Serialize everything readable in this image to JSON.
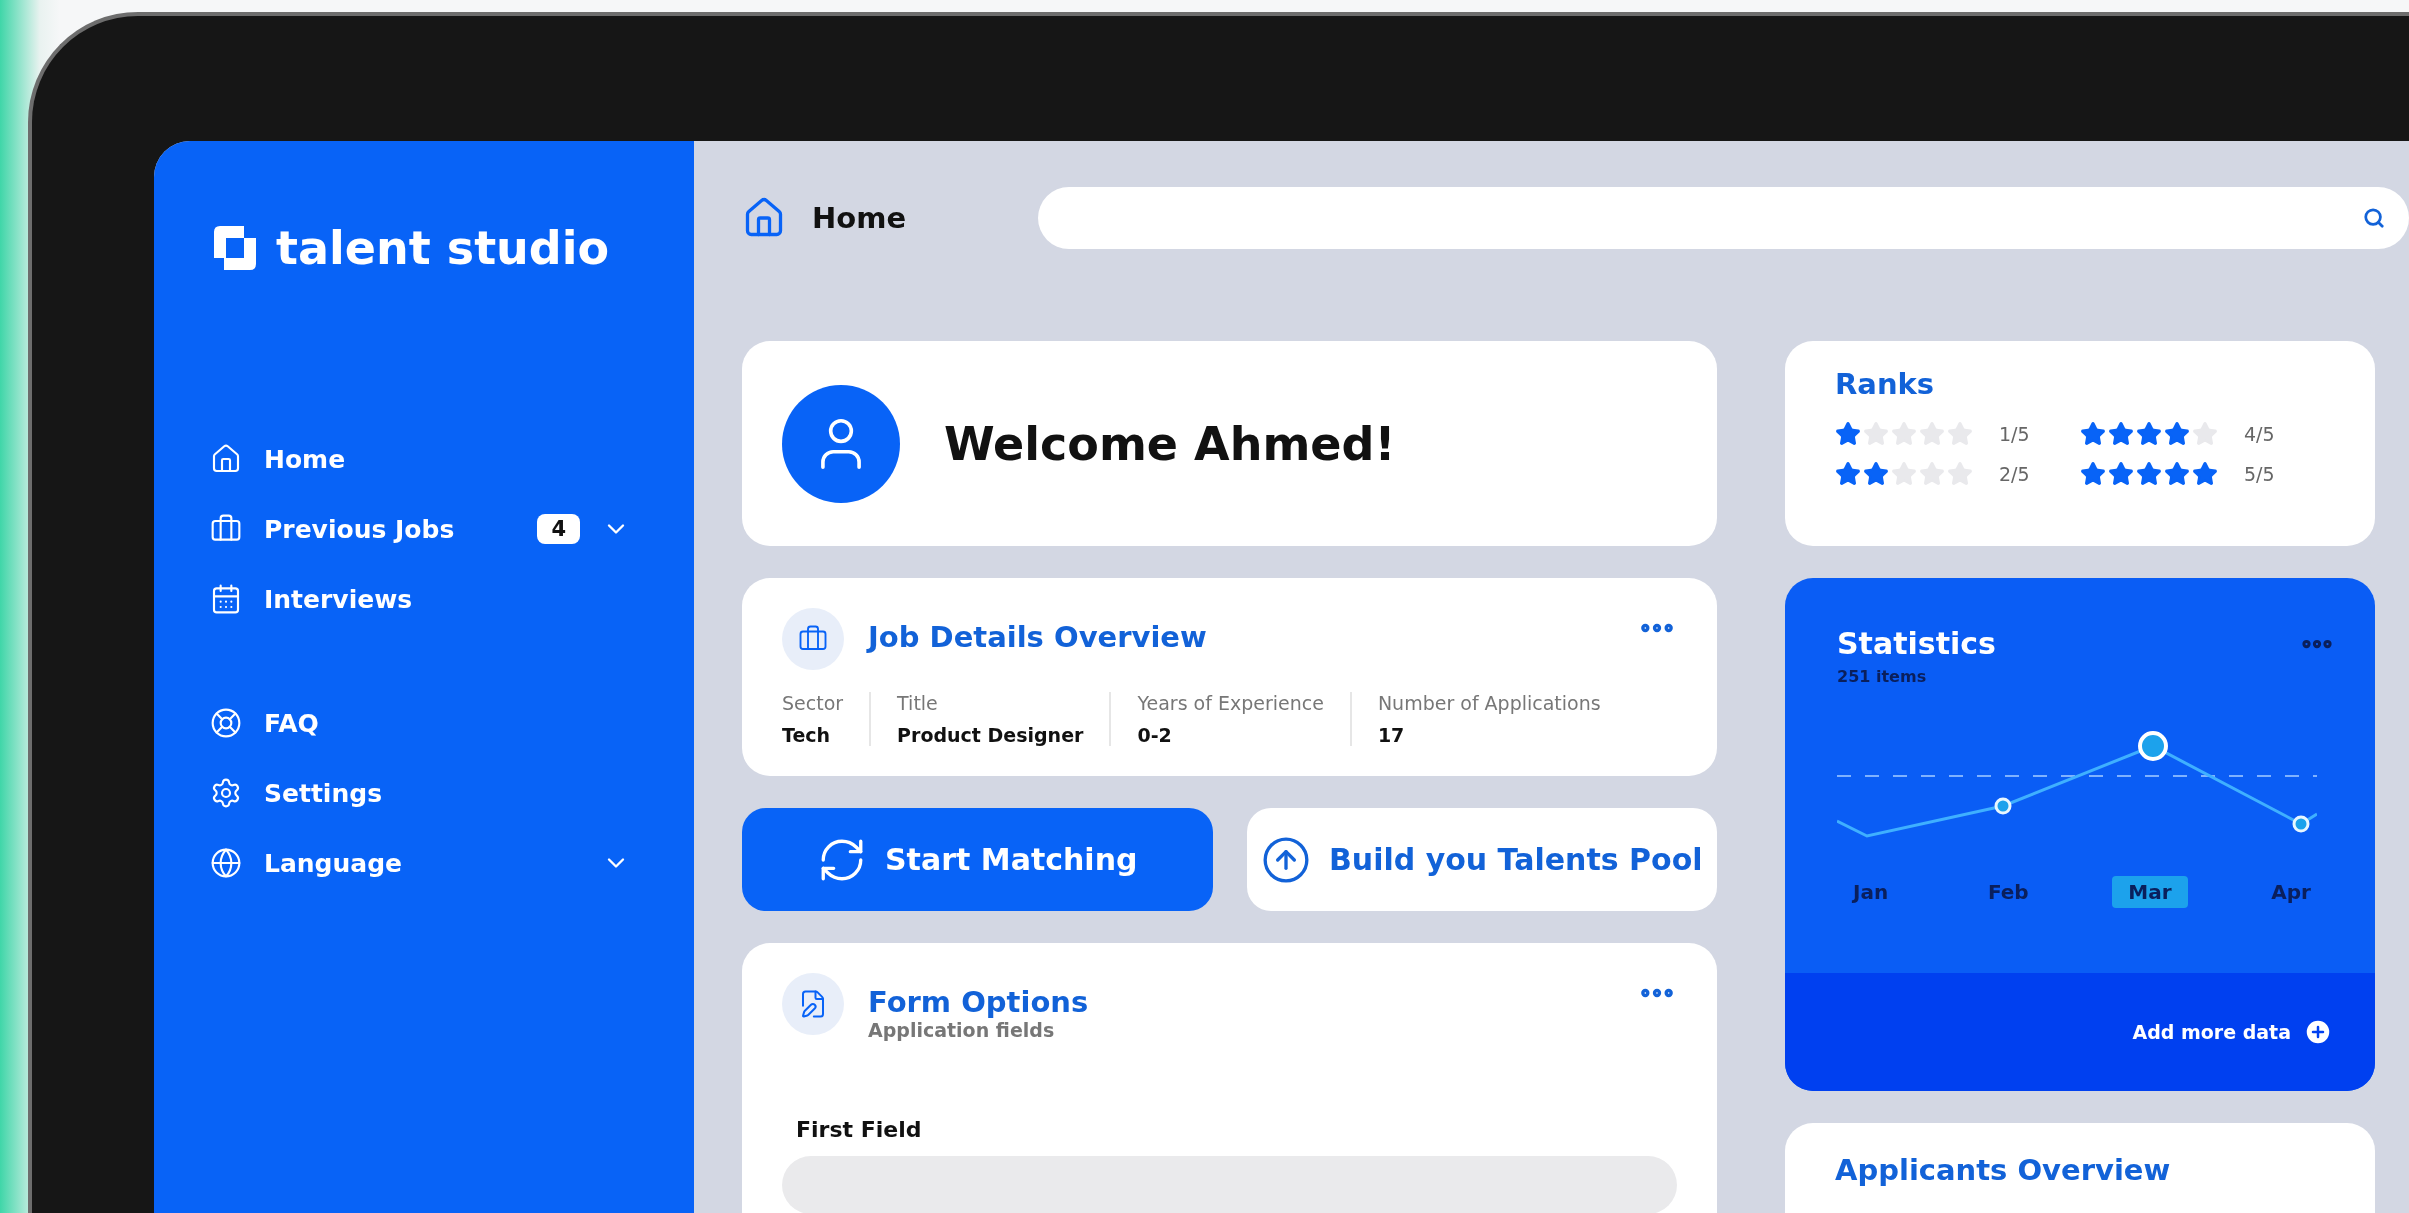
{
  "sidebar": {
    "logo": "talent studio",
    "nav": [
      {
        "label": "Home",
        "expandable": false
      },
      {
        "label": "Previous Jobs",
        "badge": "4",
        "expandable": true
      },
      {
        "label": "Interviews",
        "expandable": false
      }
    ],
    "nav_secondary": [
      {
        "label": "FAQ",
        "expandable": false
      },
      {
        "label": "Settings",
        "expandable": false
      },
      {
        "label": "Language",
        "expandable": true
      }
    ]
  },
  "header": {
    "title": "Home"
  },
  "welcome": {
    "text": "Welcome Ahmed!"
  },
  "job_details": {
    "title": "Job Details Overview",
    "fields": [
      {
        "label": "Sector",
        "value": "Tech"
      },
      {
        "label": "Title",
        "value": "Product Designer"
      },
      {
        "label": "Years of Experience",
        "value": "0-2"
      },
      {
        "label": "Number of Applications",
        "value": "17"
      }
    ]
  },
  "actions": [
    {
      "label": "Start Matching",
      "kind": "primary"
    },
    {
      "label": "Build you Talents Pool",
      "kind": "secondary"
    }
  ],
  "form_options": {
    "title": "Form Options",
    "subtitle": "Application fields",
    "fields": [
      {
        "label": "First Field"
      }
    ]
  },
  "ranks": {
    "title": "Ranks",
    "items": [
      {
        "stars": 1,
        "reading": "1/5"
      },
      {
        "stars": 4,
        "reading": "4/5"
      },
      {
        "stars": 2,
        "reading": "2/5"
      },
      {
        "stars": 5,
        "reading": "5/5"
      }
    ]
  },
  "statistics": {
    "title": "Statistics",
    "subtitle": "251 items",
    "months": [
      {
        "label": "Jan",
        "selected": false
      },
      {
        "label": "Feb",
        "selected": false
      },
      {
        "label": "Mar",
        "selected": true
      },
      {
        "label": "Apr",
        "selected": false
      }
    ],
    "add_more": "Add more data"
  },
  "applicants": {
    "title": "Applicants Overview"
  }
}
